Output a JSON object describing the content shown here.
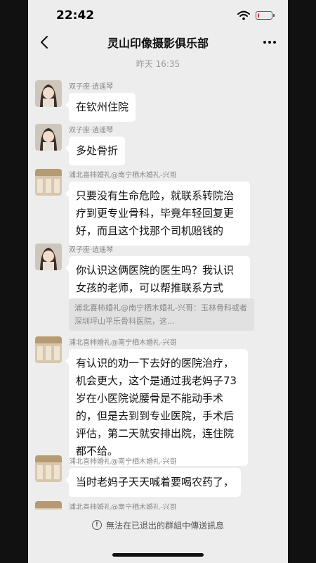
{
  "status_bar": {
    "time": "22:42",
    "battery_level": 0.15,
    "battery_color": "#e33333"
  },
  "nav": {
    "title": "灵山印像摄影俱乐部",
    "back_icon": "chevron-left-icon",
    "more_icon": "more-dots-icon"
  },
  "timestamp": "昨天 16:35",
  "messages": [
    {
      "sender": "双子座·逍遥琴",
      "avatar": "anime-girl-avatar",
      "text": "在钦州住院"
    },
    {
      "sender": "双子座·逍遥琴",
      "avatar": "anime-girl-avatar",
      "text": "多处骨折"
    },
    {
      "sender": "浦北喜柿婚礼@南宁栖木婚礼-兴哥",
      "avatar": "shop-photo-avatar",
      "text": "只要没有生命危险，就联系转院治疗到更专业骨科，毕竟年轻回复更好，而且这个找那个司机赔钱的"
    },
    {
      "sender": "双子座·逍遥琴",
      "avatar": "anime-girl-avatar",
      "text": "你认识这俩医院的医生吗？我认识女孩的老师，可以帮推联系方式",
      "quote": "浦北喜柿婚礼@南宁栖木婚礼-兴哥：玉林骨科或者深圳坪山平乐骨科医院，这..."
    },
    {
      "sender": "浦北喜柿婚礼@南宁栖木婚礼-兴哥",
      "avatar": "shop-photo-avatar",
      "text": "有认识的劝一下去好的医院治疗，机会更大，这个是通过我老妈子73岁在小医院说腰骨是不能动手术的，但是去到到专业医院，手术后评估，第二天就安排出院，连住院都不给。"
    },
    {
      "sender": "浦北喜柿婚礼@南宁栖木婚礼-兴哥",
      "avatar": "shop-photo-avatar",
      "text": "当时老妈子天天喊着要喝农药了，"
    },
    {
      "sender": "浦北喜柿婚礼@南宁栖木婚礼-兴哥",
      "avatar": "shop-photo-avatar",
      "text": ""
    }
  ],
  "footer": {
    "icon": "info-circle-icon",
    "text": "無法在已退出的群組中傳送訊息"
  }
}
